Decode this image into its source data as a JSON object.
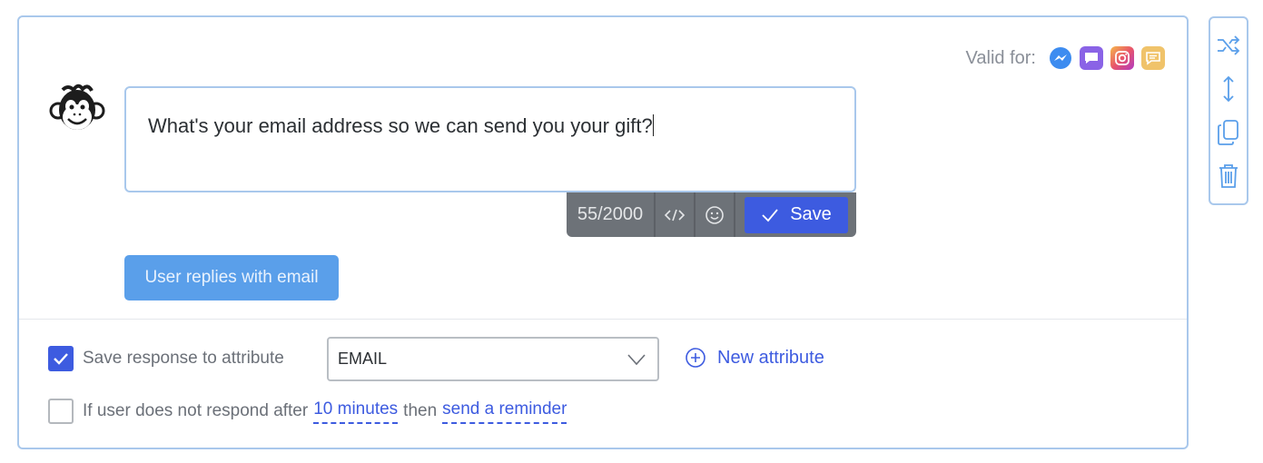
{
  "valid_for": {
    "label": "Valid for:",
    "channels": [
      {
        "name": "messenger",
        "color": "#3d8cf0"
      },
      {
        "name": "live-chat",
        "color": "#8a63e6"
      },
      {
        "name": "instagram",
        "color": "#e8556a"
      },
      {
        "name": "sms",
        "color": "#f0c36a"
      }
    ]
  },
  "message": {
    "text": "What's your email address so we can send you your gift?",
    "char_count": "55/2000"
  },
  "toolbar": {
    "save_label": "Save"
  },
  "reply_button": {
    "label": "User replies with email"
  },
  "save_attribute": {
    "checked": true,
    "label": "Save response to attribute",
    "selected_value": "EMAIL",
    "new_attribute_label": "New attribute"
  },
  "reminder": {
    "checked": false,
    "prefix": "If user does not respond after",
    "duration_link": "10 minutes",
    "middle": "then",
    "action_link": "send a reminder"
  },
  "colors": {
    "accent": "#3d5be0",
    "card_border": "#a9c8ec",
    "reply_button": "#5a9fea"
  }
}
